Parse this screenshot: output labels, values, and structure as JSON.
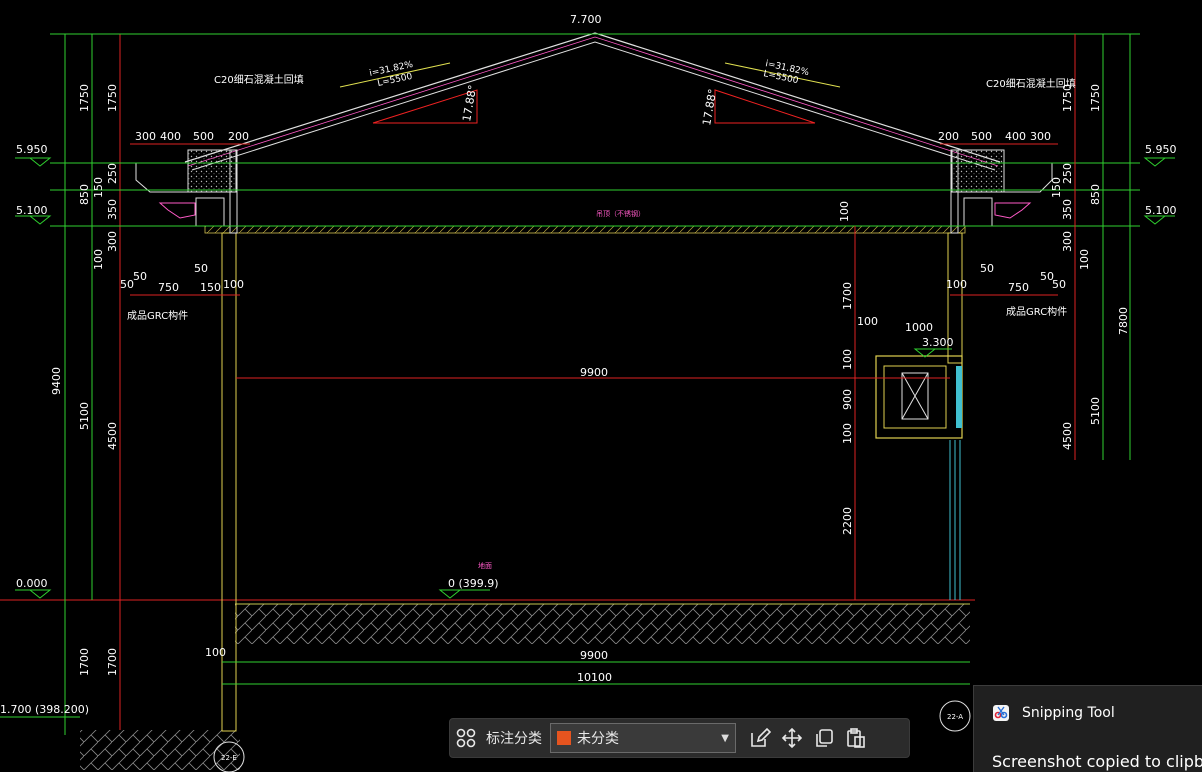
{
  "drawing": {
    "elevations": {
      "ridge": "7.700",
      "eave_left": "5.950",
      "eave_right": "5.950",
      "ceiling_left": "5.100",
      "ceiling_right": "5.100",
      "ground": "0.000",
      "foundation": "1.700 (398.200)",
      "window_sill": "3.300",
      "floor_note": "0 (399.9)"
    },
    "roof": {
      "slope_left_i": "i=31.82%",
      "slope_left_l": "L=5500",
      "slope_right_i": "i=31.82%",
      "slope_right_l": "L=5500",
      "angle_left": "17.88°",
      "angle_right": "17.88°",
      "parapet_note_left": "C20细石混凝土回填",
      "parapet_note_right": "C20细石混凝土回填",
      "ceiling_note": "吊顶（不锈钢）",
      "floor_room_note": "地面"
    },
    "components": {
      "grc_left": "成品GRC构件",
      "grc_right": "成品GRC构件"
    },
    "dimensions": {
      "top_left": [
        "300",
        "400",
        "500",
        "200"
      ],
      "top_right": [
        "200",
        "500",
        "400",
        "300"
      ],
      "span_mid": "9900",
      "span_bottom_inner": "9900",
      "span_bottom_outer": "10100",
      "left_outer": "9400",
      "left_a": "1750",
      "left_b": "850",
      "left_c": "5100",
      "left_d": "1700",
      "left_e": "4500",
      "right_outer": "7800",
      "right_a": "1750",
      "right_b": "850",
      "right_c": "5100",
      "right_d": "4500",
      "small_250": "250",
      "small_150": "150",
      "small_350": "350",
      "small_50": "50",
      "small_300": "300",
      "small_100": "100",
      "small_750": "750",
      "window_1700": "1700",
      "window_100": "100",
      "window_1000": "1000",
      "window_900": "900",
      "window_2200": "2200"
    },
    "axis_tags": {
      "left": "22-E",
      "right": "22-A"
    }
  },
  "toolbar": {
    "grid_icon": "grid-icon",
    "category_label": "标注分类",
    "category_value": "未分类",
    "category_color": "#e6541f",
    "edit_icon": "edit-icon",
    "move_icon": "move-icon",
    "copy_icon": "copy-icon",
    "paste_icon": "paste-icon"
  },
  "toast": {
    "app_name": "Snipping Tool",
    "message": "Screenshot copied to clipbo"
  }
}
